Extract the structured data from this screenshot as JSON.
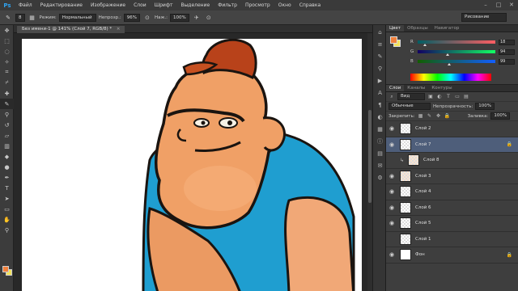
{
  "app": {
    "logo": "Ps",
    "menu": [
      "Файл",
      "Редактирование",
      "Изображение",
      "Слои",
      "Шрифт",
      "Выделение",
      "Фильтр",
      "Просмотр",
      "Окно",
      "Справка"
    ],
    "window_controls": [
      "–",
      "□",
      "✕"
    ]
  },
  "options": {
    "brush_size": "8",
    "mode_label": "Режим:",
    "mode_value": "Нормальный",
    "opacity_label": "Непрозр.:",
    "opacity_value": "96%",
    "pressure_label": "Наж.:",
    "pressure_value": "100%",
    "workspace": "Рисование"
  },
  "document": {
    "tab_title": "Без имени-1 @ 141% (Слой 7, RGB/8) *",
    "close": "×"
  },
  "color_panel": {
    "tabs": [
      "Цвет",
      "Образцы",
      "Навигатор"
    ],
    "active_tab": "Цвет",
    "fg_color": "#f0803c",
    "bg_color": "#f3e35c",
    "channels": [
      {
        "label": "R",
        "value": "18",
        "level": 0.07
      },
      {
        "label": "G",
        "value": "94",
        "level": 0.37
      },
      {
        "label": "B",
        "value": "99",
        "level": 0.39
      }
    ]
  },
  "layers_panel": {
    "tabs": [
      "Слои",
      "Каналы",
      "Контуры"
    ],
    "active_tab": "Слои",
    "filter_kind": "Вид",
    "blend_mode": "Обычные",
    "opacity_label": "Непрозрачность:",
    "opacity_value": "100%",
    "lock_label": "Закрепить:",
    "fill_label": "Заливка:",
    "fill_value": "100%",
    "layers": [
      {
        "name": "Слой 2",
        "visible": true,
        "thumb": "transparent",
        "locked": false,
        "selected": false,
        "clipped": false
      },
      {
        "name": "Слой 7",
        "visible": true,
        "thumb": "transparent",
        "locked": true,
        "selected": true,
        "clipped": false
      },
      {
        "name": "Слой 8",
        "visible": false,
        "thumb": "sketch",
        "locked": false,
        "selected": false,
        "clipped": true
      },
      {
        "name": "Слой 3",
        "visible": true,
        "thumb": "sketch",
        "locked": false,
        "selected": false,
        "clipped": false
      },
      {
        "name": "Слой 4",
        "visible": true,
        "thumb": "transparent",
        "locked": false,
        "selected": false,
        "clipped": false
      },
      {
        "name": "Слой 6",
        "visible": true,
        "thumb": "transparent",
        "locked": false,
        "selected": false,
        "clipped": false
      },
      {
        "name": "Слой 5",
        "visible": true,
        "thumb": "transparent",
        "locked": false,
        "selected": false,
        "clipped": false
      },
      {
        "name": "Слой 1",
        "visible": false,
        "thumb": "transparent",
        "locked": false,
        "selected": false,
        "clipped": false
      },
      {
        "name": "Фон",
        "visible": true,
        "thumb": "white",
        "locked": true,
        "selected": false,
        "clipped": false
      }
    ]
  },
  "tools": [
    "move-tool",
    "marquee-tool",
    "lasso-tool",
    "quick-select-tool",
    "crop-tool",
    "eyedropper-tool",
    "healing-tool",
    "brush-tool",
    "clone-stamp-tool",
    "history-brush-tool",
    "eraser-tool",
    "gradient-tool",
    "blur-tool",
    "dodge-tool",
    "pen-tool",
    "type-tool",
    "path-select-tool",
    "shape-tool",
    "hand-tool",
    "zoom-tool"
  ]
}
